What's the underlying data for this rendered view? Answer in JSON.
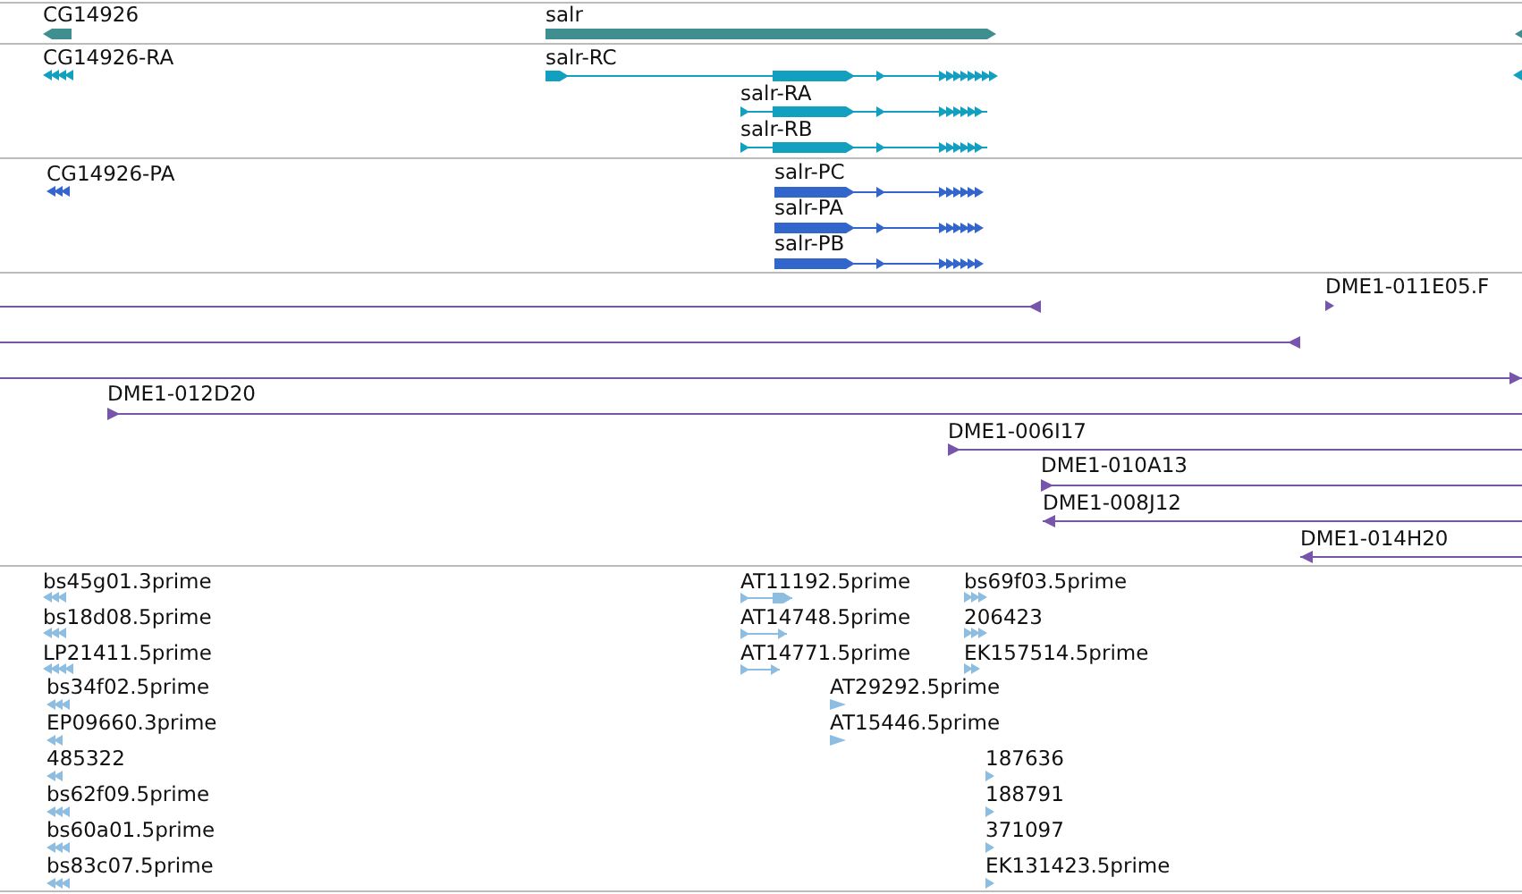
{
  "tracks": [
    {
      "kind": "gene",
      "features": [
        {
          "label": "CG14926",
          "reverse": true
        },
        {
          "label": "salr",
          "reverse": false
        },
        {
          "reverse": true
        }
      ]
    },
    {
      "kind": "transcript",
      "features": [
        {
          "label": "CG14926-RA",
          "reverse": true
        },
        {
          "label": "salr-RC",
          "reverse": false
        },
        {
          "label": "salr-RA",
          "reverse": false
        },
        {
          "label": "salr-RB",
          "reverse": false
        },
        {
          "reverse": true
        }
      ]
    },
    {
      "kind": "protein",
      "features": [
        {
          "label": "CG14926-PA",
          "reverse": true
        },
        {
          "label": "salr-PC",
          "reverse": false
        },
        {
          "label": "salr-PA",
          "reverse": false
        },
        {
          "label": "salr-PB",
          "reverse": false
        }
      ]
    },
    {
      "kind": "clone",
      "features": [
        {
          "reverse": true
        },
        {
          "label": "DME1-011E05.F",
          "reverse": false
        },
        {
          "reverse": true
        },
        {
          "reverse": false
        },
        {
          "label": "DME1-012D20",
          "reverse": false
        },
        {
          "label": "DME1-006I17",
          "reverse": false
        },
        {
          "label": "DME1-010A13",
          "reverse": false
        },
        {
          "label": "DME1-008J12",
          "reverse": true
        },
        {
          "label": "DME1-014H20",
          "reverse": true
        }
      ]
    },
    {
      "kind": "est",
      "features": [
        {
          "label": "bs45g01.3prime",
          "reverse": true
        },
        {
          "label": "bs18d08.5prime",
          "reverse": true
        },
        {
          "label": "LP21411.5prime",
          "reverse": true
        },
        {
          "label": "bs34f02.5prime",
          "reverse": true
        },
        {
          "label": "EP09660.3prime",
          "reverse": true
        },
        {
          "label": "485322",
          "reverse": true
        },
        {
          "label": "bs62f09.5prime",
          "reverse": true
        },
        {
          "label": "bs60a01.5prime",
          "reverse": true
        },
        {
          "label": "bs83c07.5prime",
          "reverse": true
        },
        {
          "label": "AT11192.5prime",
          "reverse": false
        },
        {
          "label": "AT14748.5prime",
          "reverse": false
        },
        {
          "label": "AT14771.5prime",
          "reverse": false
        },
        {
          "label": "AT29292.5prime",
          "reverse": false
        },
        {
          "label": "AT15446.5prime",
          "reverse": false
        },
        {
          "label": "bs69f03.5prime",
          "reverse": false
        },
        {
          "label": "206423",
          "reverse": false
        },
        {
          "label": "EK157514.5prime",
          "reverse": false
        },
        {
          "label": "187636",
          "reverse": false
        },
        {
          "label": "188791",
          "reverse": false
        },
        {
          "label": "371097",
          "reverse": false
        },
        {
          "label": "EK131423.5prime",
          "reverse": false
        }
      ]
    }
  ]
}
